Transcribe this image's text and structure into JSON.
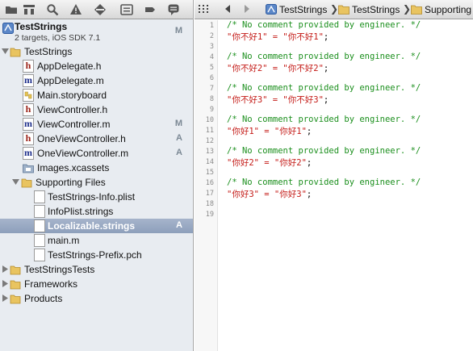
{
  "navigator": {
    "toolbar_icons": [
      "folder-icon",
      "hierarchy-icon",
      "search-icon",
      "warning-icon",
      "diamond-icon",
      "list-icon",
      "tag-icon",
      "speech-bubble-icon"
    ],
    "project": {
      "name": "TestStrings",
      "subtitle": "2 targets, iOS SDK 7.1",
      "badge": "M"
    },
    "tree": [
      {
        "label": "TestStrings",
        "kind": "folder",
        "badge": ""
      },
      {
        "label": "AppDelegate.h",
        "kind": "h",
        "badge": ""
      },
      {
        "label": "AppDelegate.m",
        "kind": "m",
        "badge": ""
      },
      {
        "label": "Main.storyboard",
        "kind": "storyboard",
        "badge": ""
      },
      {
        "label": "ViewController.h",
        "kind": "h",
        "badge": ""
      },
      {
        "label": "ViewController.m",
        "kind": "m",
        "badge": "M"
      },
      {
        "label": "OneViewController.h",
        "kind": "h",
        "badge": "A"
      },
      {
        "label": "OneViewController.m",
        "kind": "m",
        "badge": "A"
      },
      {
        "label": "Images.xcassets",
        "kind": "assets",
        "badge": ""
      },
      {
        "label": "Supporting Files",
        "kind": "folder",
        "badge": ""
      },
      {
        "label": "TestStrings-Info.plist",
        "kind": "doc",
        "badge": ""
      },
      {
        "label": "InfoPlist.strings",
        "kind": "doc",
        "badge": ""
      },
      {
        "label": "Localizable.strings",
        "kind": "doc",
        "badge": "A"
      },
      {
        "label": "main.m",
        "kind": "doc",
        "badge": ""
      },
      {
        "label": "TestStrings-Prefix.pch",
        "kind": "doc",
        "badge": ""
      },
      {
        "label": "TestStringsTests",
        "kind": "folder",
        "badge": ""
      },
      {
        "label": "Frameworks",
        "kind": "folder",
        "badge": ""
      },
      {
        "label": "Products",
        "kind": "folder",
        "badge": ""
      }
    ]
  },
  "jumpbar": {
    "crumbs": [
      "TestStrings",
      "TestStrings",
      "Supporting"
    ],
    "separator": "❯"
  },
  "editor": {
    "line_numbers": [
      "1",
      "2",
      "3",
      "4",
      "5",
      "6",
      "7",
      "8",
      "9",
      "10",
      "11",
      "12",
      "13",
      "14",
      "15",
      "16",
      "17",
      "18",
      "19"
    ],
    "lines": [
      "/* No comment provided by engineer. */",
      "\"你不好1\" = \"你不好1\";",
      "",
      "/* No comment provided by engineer. */",
      "\"你不好2\" = \"你不好2\";",
      "",
      "/* No comment provided by engineer. */",
      "\"你不好3\" = \"你不好3\";",
      "",
      "/* No comment provided by engineer. */",
      "\"你好1\" = \"你好1\";",
      "",
      "/* No comment provided by engineer. */",
      "\"你好2\" = \"你好2\";",
      "",
      "/* No comment provided by engineer. */",
      "\"你好3\" = \"你好3\";",
      "",
      ""
    ]
  },
  "colors": {
    "comment": "#1b8f1d",
    "string": "#c41a16",
    "selection": "#8d9fbb",
    "navigator_bg": "#e8ecf1"
  }
}
